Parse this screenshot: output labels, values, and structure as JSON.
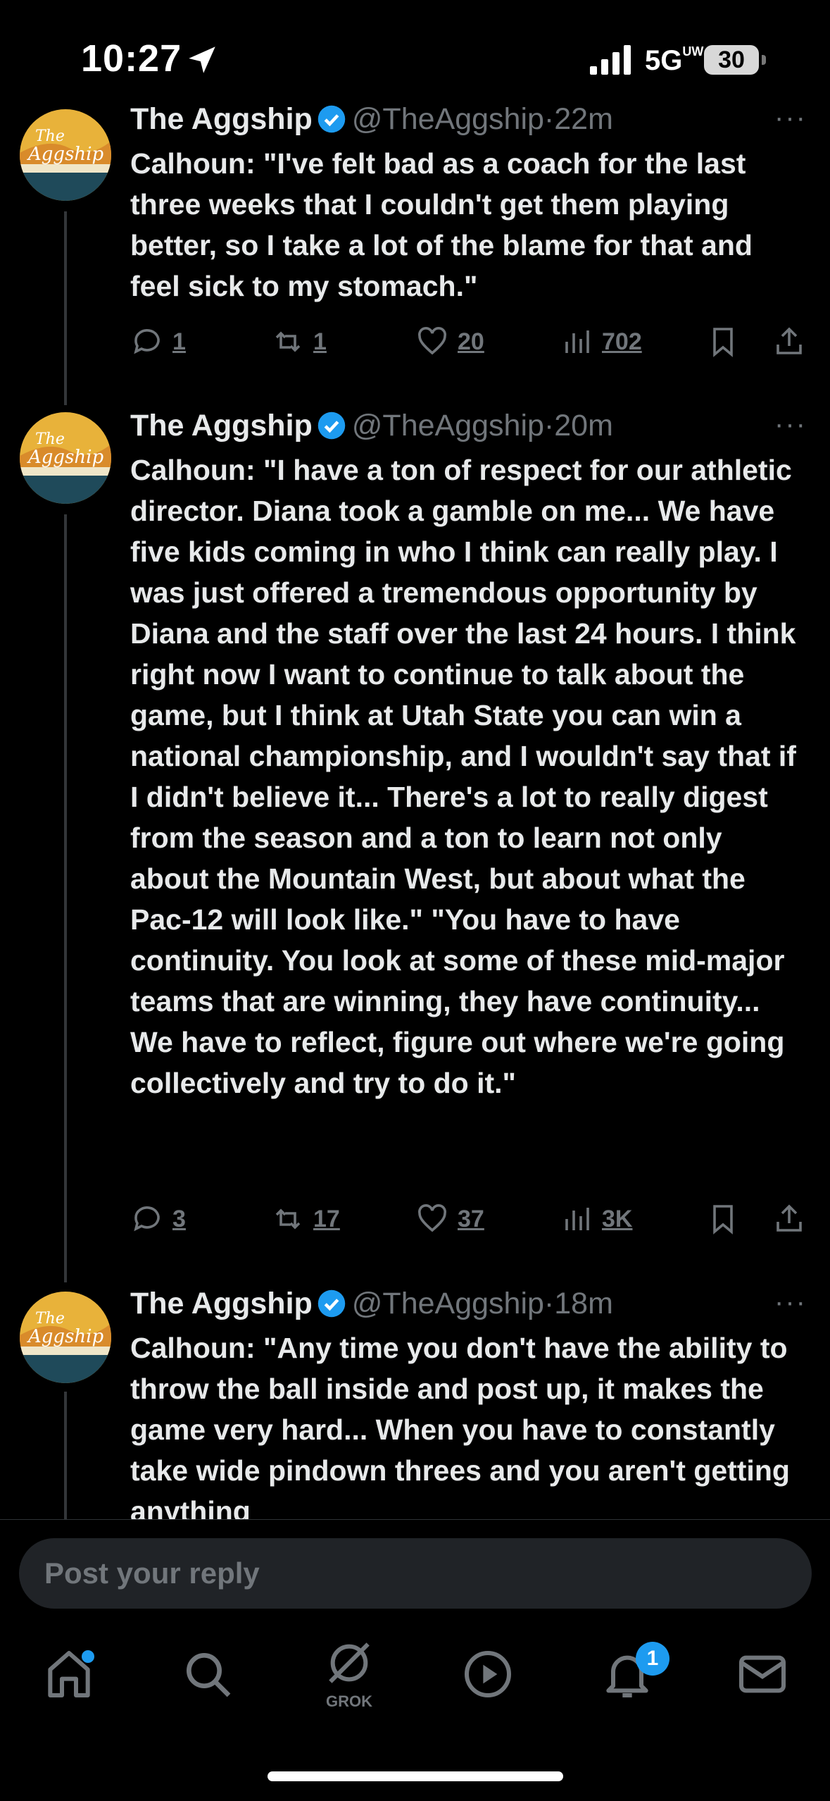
{
  "status_bar": {
    "time": "10:27",
    "network": "5G",
    "network_sup": "UW",
    "battery": "30"
  },
  "tweets": [
    {
      "name": "The Aggship",
      "handle": "@TheAggship",
      "time": "22m",
      "text": "Calhoun: \"I've felt bad as a coach for the last three weeks that I couldn't get them playing better, so I take a lot of the blame for that and feel sick to my stomach.\"",
      "replies": "1",
      "reposts": "1",
      "likes": "20",
      "views": "702",
      "avatar_text_1": "The",
      "avatar_text_2": "Aggship"
    },
    {
      "name": "The Aggship",
      "handle": "@TheAggship",
      "time": "20m",
      "text": "Calhoun: \"I have a ton of respect for our athletic director. Diana took a gamble on me... We have five kids coming in who I think can really play. I was just offered a tremendous opportunity by Diana and the staff over the last 24 hours. I think right now I want to continue to talk about the game, but I think at Utah State you can win a national championship, and I wouldn't say that if I didn't believe it... There's a lot to really digest from the season and a ton to learn not only about the Mountain West, but about what the Pac-12 will look like.\" \"You have to have continuity. You look at some of these mid-major teams that are winning, they have continuity... We have to reflect, figure out where we're going collectively and try to do it.\"",
      "replies": "3",
      "reposts": "17",
      "likes": "37",
      "views": "3K",
      "avatar_text_1": "The",
      "avatar_text_2": "Aggship"
    },
    {
      "name": "The Aggship",
      "handle": "@TheAggship",
      "time": "18m",
      "text": "Calhoun: \"Any time you don't have the ability to throw the ball inside and post up, it makes the game very hard... When you have to constantly take wide pindown threes and you aren't getting anything",
      "avatar_text_1": "The",
      "avatar_text_2": "Aggship"
    }
  ],
  "reply": {
    "placeholder": "Post your reply"
  },
  "tabbar": {
    "grok_label": "GROK",
    "notifications_badge": "1"
  },
  "colors": {
    "accent": "#1d9bf0",
    "muted": "#71767b",
    "text": "#e7e9ea"
  }
}
